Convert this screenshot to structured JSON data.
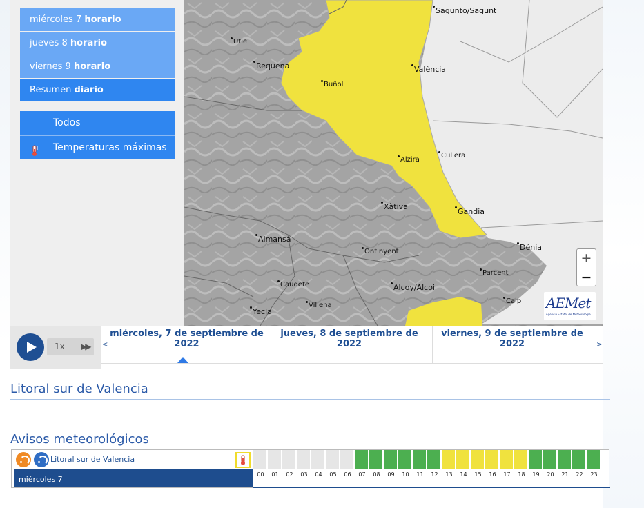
{
  "menu": {
    "days": [
      {
        "pre": "miércoles 7 ",
        "bold": "horario"
      },
      {
        "pre": "jueves 8 ",
        "bold": "horario"
      },
      {
        "pre": "viernes 9 ",
        "bold": "horario"
      },
      {
        "pre": "Resumen ",
        "bold": "diario"
      }
    ],
    "layers": [
      {
        "label": "Todos"
      },
      {
        "label": "Temperaturas máximas",
        "icon": "thermometer-icon"
      }
    ]
  },
  "map": {
    "cities": [
      "Sagunto/Sagunt",
      "Utiel",
      "Requena",
      "València",
      "Buñol",
      "Alzira",
      "Cullera",
      "Xàtiva",
      "Gandia",
      "Almansa",
      "Ontinyent",
      "Dénia",
      "Parcent",
      "Caudete",
      "Alcoy/Alcoi",
      "Villena",
      "Yecla",
      "Calp"
    ],
    "zoom_in": "+",
    "zoom_out": "−",
    "logo": "AEMet",
    "logo_sub": "Agencia Estatal de Meteorología",
    "colors": {
      "warning": "#f0e23e",
      "terrain": "#a6a6a6",
      "sea": "#ececec"
    }
  },
  "timeline": {
    "speed": "1x",
    "play_icon": "play-icon",
    "ff_icon": "fast-forward-icon",
    "prev": "<",
    "next": ">",
    "days": [
      "miércoles, 7 de septiembre de 2022",
      "jueves, 8 de septiembre de 2022",
      "viernes, 9 de septiembre de 2022"
    ],
    "active_index": 0
  },
  "zone_title": "Litoral sur de Valencia",
  "warnings": {
    "title": "Avisos meteorológicos",
    "zone_link": "Litoral sur de Valencia",
    "day_label": "miércoles 7",
    "hours": [
      "00",
      "01",
      "02",
      "03",
      "04",
      "05",
      "06",
      "07",
      "08",
      "09",
      "10",
      "11",
      "12",
      "13",
      "14",
      "15",
      "16",
      "17",
      "18",
      "19",
      "20",
      "21",
      "22",
      "23"
    ],
    "levels": [
      "none",
      "none",
      "none",
      "none",
      "none",
      "none",
      "none",
      "green",
      "green",
      "green",
      "green",
      "green",
      "green",
      "yellow",
      "yellow",
      "yellow",
      "yellow",
      "yellow",
      "yellow",
      "green",
      "green",
      "green",
      "green",
      "green"
    ],
    "level_colors": {
      "none": "#e6e6e6",
      "green": "#4caf50",
      "yellow": "#f0e23e"
    }
  }
}
